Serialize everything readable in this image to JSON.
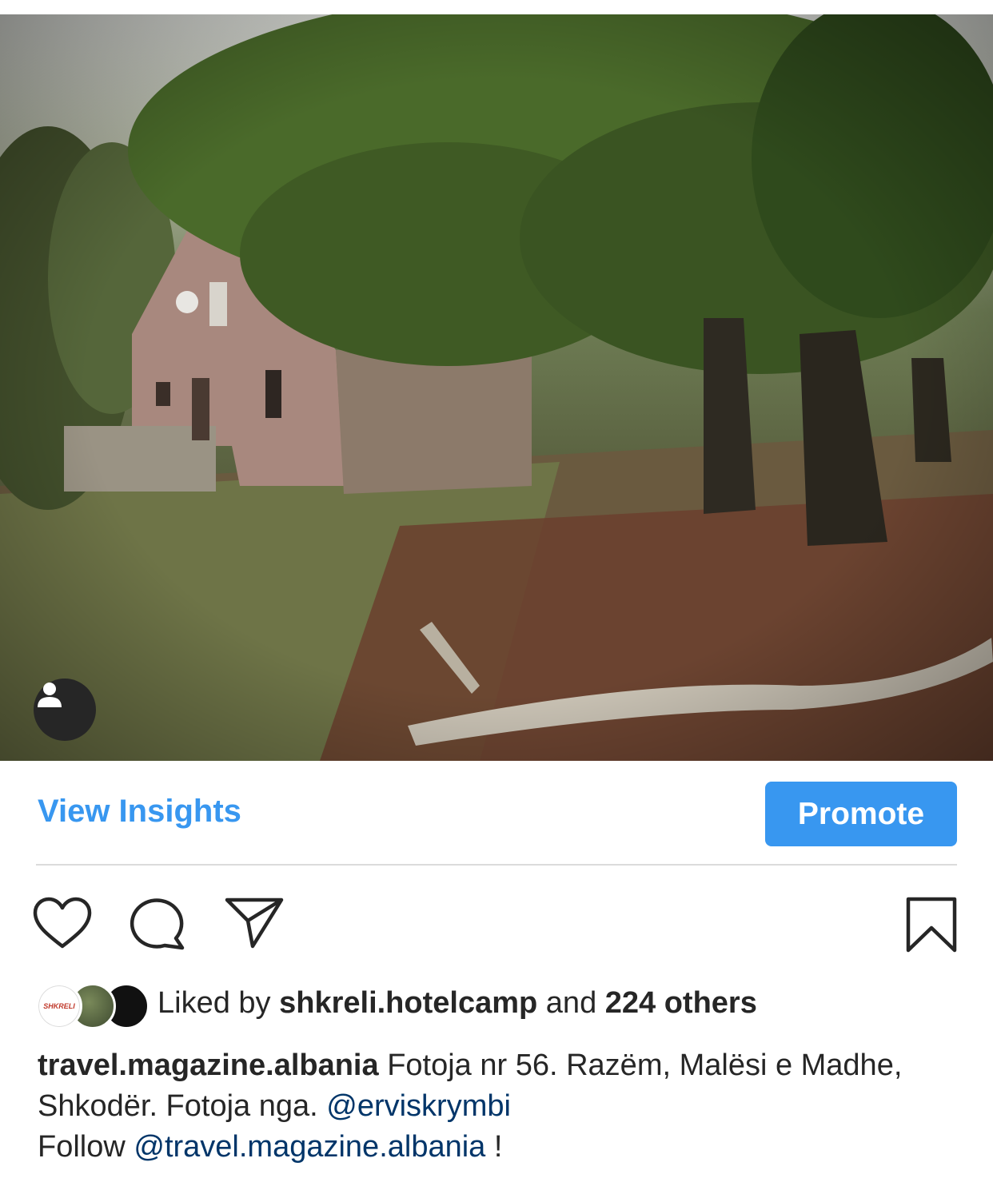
{
  "post": {
    "photo_alt": "Abandoned house in the forest",
    "tag_icon": "person-icon"
  },
  "insights": {
    "view_insights_label": "View Insights",
    "promote_label": "Promote"
  },
  "actions": {
    "like_icon": "heart-icon",
    "comment_icon": "comment-icon",
    "share_icon": "paper-plane-icon",
    "save_icon": "bookmark-icon"
  },
  "likes": {
    "prefix": "Liked by",
    "user": "shkreli.hotelcamp",
    "conjunction": "and",
    "others": "224 others",
    "avatar_1_text": "SHKRELI"
  },
  "caption": {
    "username": "travel.magazine.albania",
    "text": "Fotoja nr 56. Razëm, Malësi e Madhe, Shkodër. Fotoja nga.",
    "mention_1": "@erviskrymbi",
    "follow_prefix": "Follow",
    "mention_2": "@travel.magazine.albania",
    "follow_suffix": "!"
  },
  "colors": {
    "accent": "#3897f0",
    "mention": "#003569",
    "text": "#262626",
    "divider": "#dbdbdb"
  }
}
